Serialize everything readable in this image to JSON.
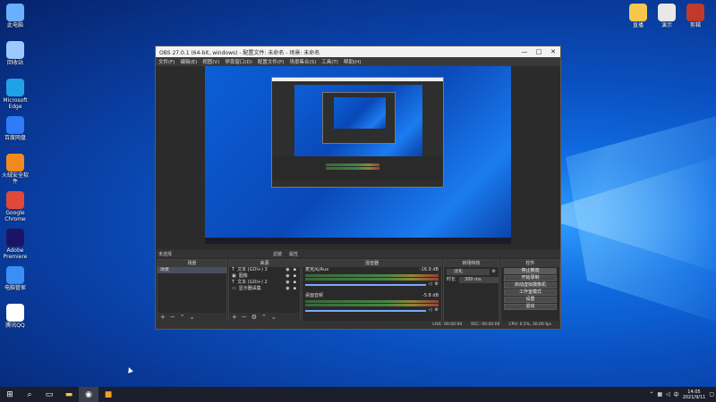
{
  "desktop": {
    "left_icons": [
      {
        "label": "此电脑",
        "icon": "computer-icon",
        "color": "#6ab0ff"
      },
      {
        "label": "回收站",
        "icon": "recycle-bin-icon",
        "color": "#9ccaff"
      },
      {
        "label": "Microsoft Edge",
        "icon": "edge-icon",
        "color": "#1fa2e8"
      },
      {
        "label": "百度网盘",
        "icon": "baidu-netdisk-icon",
        "color": "#2e7cf6"
      },
      {
        "label": "火绒安全软件",
        "icon": "huorong-icon",
        "color": "#f08a1c"
      },
      {
        "label": "Google Chrome",
        "icon": "chrome-icon",
        "color": "#e0493a"
      },
      {
        "label": "Adobe Premiere",
        "icon": "premiere-icon",
        "color": "#1b1464"
      },
      {
        "label": "电脑管家",
        "icon": "pc-manager-icon",
        "color": "#3a8ef6"
      },
      {
        "label": "腾讯QQ",
        "icon": "qq-icon",
        "color": "#ffffff"
      }
    ],
    "right_icons": [
      {
        "label": "直播",
        "icon": "folder-icon",
        "color": "#f5c84b"
      },
      {
        "label": "演示",
        "icon": "file-icon",
        "color": "#e8e8e8"
      },
      {
        "label": "剪辑",
        "icon": "document-icon",
        "color": "#c0392b"
      }
    ]
  },
  "obs": {
    "title": "OBS 27.0.1 (64-bit, windows) - 配置文件: 未命名 - 场景: 未命名",
    "menu": [
      "文件(F)",
      "编辑(E)",
      "视图(V)",
      "停靠窗口(D)",
      "配置文件(P)",
      "场景集合(S)",
      "工具(T)",
      "帮助(H)"
    ],
    "scene_bar": {
      "label": "未选择",
      "filter": "滤镜",
      "properties": "属性"
    },
    "docks": {
      "scenes": {
        "title": "场景",
        "items": [
          "场景"
        ]
      },
      "sources": {
        "title": "来源",
        "items": [
          "文本 (GDI+) 3",
          "图像",
          "文本 (GDI+) 2",
          "显示器采集"
        ]
      },
      "mixer": {
        "title": "混音器",
        "channels": [
          {
            "name": "麦克风/Aux",
            "db": "-16.9 dB"
          },
          {
            "name": "桌面音频",
            "db": "-5.8 dB"
          }
        ]
      },
      "transitions": {
        "title": "转场特效",
        "type": "淡化",
        "duration_label": "时长",
        "duration": "300 ms"
      },
      "controls": {
        "title": "控件",
        "buttons": [
          "停止推流",
          "开始录制",
          "启动虚拟摄像机",
          "工作室模式",
          "设置",
          "退出"
        ]
      }
    },
    "status": {
      "live": "LIVE: 00:00:00",
      "rec": "REC: 00:00:00",
      "cpu": "CPU: 0.5%, 30.00 fps"
    }
  },
  "taskbar": {
    "time": "14:05",
    "date": "2021/9/11",
    "ime": "中"
  }
}
